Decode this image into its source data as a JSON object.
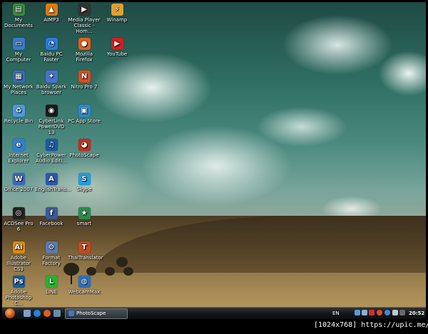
{
  "desktop": {
    "icons": [
      {
        "label": "My Documents",
        "glyph": "folder-documents-icon",
        "color": "#3a8a3a",
        "mark": "▤"
      },
      {
        "label": "AIMP3",
        "glyph": "aimp-icon",
        "color": "#e07a10",
        "mark": "▲"
      },
      {
        "label": "Media Player Classic - Hom...",
        "glyph": "media-player-icon",
        "color": "#333333",
        "mark": "▶"
      },
      {
        "label": "Winamp",
        "glyph": "winamp-icon",
        "color": "#e0a030",
        "mark": "⚡"
      },
      {
        "label": "My Computer",
        "glyph": "computer-icon",
        "color": "#3a7ac8",
        "mark": "▭"
      },
      {
        "label": "Baidu PC Faster",
        "glyph": "baidu-pc-faster-icon",
        "color": "#2a7ae0",
        "mark": "◔"
      },
      {
        "label": "Mozilla Firefox",
        "glyph": "firefox-icon",
        "color": "#e0601a",
        "mark": "●"
      },
      {
        "label": "YouTube",
        "glyph": "youtube-icon",
        "color": "#d02020",
        "mark": "▶"
      },
      {
        "label": "My Network Places",
        "glyph": "network-icon",
        "color": "#3a6ab0",
        "mark": "▦"
      },
      {
        "label": "Baidu Spark browser",
        "glyph": "spark-browser-icon",
        "color": "#4a70d0",
        "mark": "✦"
      },
      {
        "label": "Nitro Pro 7",
        "glyph": "nitro-pro-icon",
        "color": "#e04a1a",
        "mark": "N"
      },
      {
        "label": "Recycle Bin",
        "glyph": "recycle-bin-icon",
        "color": "#4a9ae0",
        "mark": "♻"
      },
      {
        "label": "CyberLink PowerDVD 13",
        "glyph": "powerdvd-icon",
        "color": "#1a1a1a",
        "mark": "◉"
      },
      {
        "label": "PC App Store",
        "glyph": "pc-app-store-icon",
        "color": "#2a8ad0",
        "mark": "▣"
      },
      {
        "label": "Internet Explorer",
        "glyph": "internet-explorer-icon",
        "color": "#2a80d8",
        "mark": "e"
      },
      {
        "label": "CyberPower Audio Editi...",
        "glyph": "audio-editor-icon",
        "color": "#1a5aa0",
        "mark": "♫"
      },
      {
        "label": "PhotoScape",
        "glyph": "photoscape-icon",
        "color": "#c03020",
        "mark": "◕"
      },
      {
        "label": "Office 2007",
        "glyph": "office-icon",
        "color": "#3a68c0",
        "mark": "W"
      },
      {
        "label": "EnglishTrans...",
        "glyph": "english-translator-icon",
        "color": "#2a58b0",
        "mark": "A"
      },
      {
        "label": "Skype",
        "glyph": "skype-icon",
        "color": "#1aa0e0",
        "mark": "S"
      },
      {
        "label": "ACDSee Pro 6",
        "glyph": "acdsee-icon",
        "color": "#222222",
        "mark": "◎"
      },
      {
        "label": "Facebook",
        "glyph": "facebook-icon",
        "color": "#3b5998",
        "mark": "f"
      },
      {
        "label": "smart",
        "glyph": "smart-icon",
        "color": "#2a8a4a",
        "mark": "★"
      },
      {
        "label": "Adobe Illustrator CS3",
        "glyph": "illustrator-icon",
        "color": "#e08a10",
        "mark": "Ai"
      },
      {
        "label": "Format Factory",
        "glyph": "format-factory-icon",
        "color": "#5a7ab0",
        "mark": "⚙"
      },
      {
        "label": "ThaiTranslator",
        "glyph": "thai-translator-icon",
        "color": "#c04a20",
        "mark": "T"
      },
      {
        "label": "Adobe Photoshop C...",
        "glyph": "photoshop-icon",
        "color": "#1a5a9a",
        "mark": "Ps"
      },
      {
        "label": "LINE",
        "glyph": "line-icon",
        "color": "#2ab030",
        "mark": "L"
      },
      {
        "label": "WebcamMax",
        "glyph": "webcammax-icon",
        "color": "#2a70c0",
        "mark": "◍"
      }
    ]
  },
  "taskbar": {
    "start_icon": "windows-orb-icon",
    "quick_launch": [
      "show-desktop-icon",
      "ie-quicklaunch-icon",
      "firefox-quicklaunch-icon",
      "windows-switcher-icon"
    ],
    "task_button_label": "PhotoScape",
    "language": "EN",
    "tray_icons": [
      "network-tray-icon",
      "monitor-tray-icon",
      "antivirus-tray-icon",
      "security-tray-icon",
      "update-tray-icon",
      "volume-tray-icon",
      "media-tray-icon"
    ],
    "clock": "20:52"
  },
  "caption": "[1024x768] https://upic.me/"
}
